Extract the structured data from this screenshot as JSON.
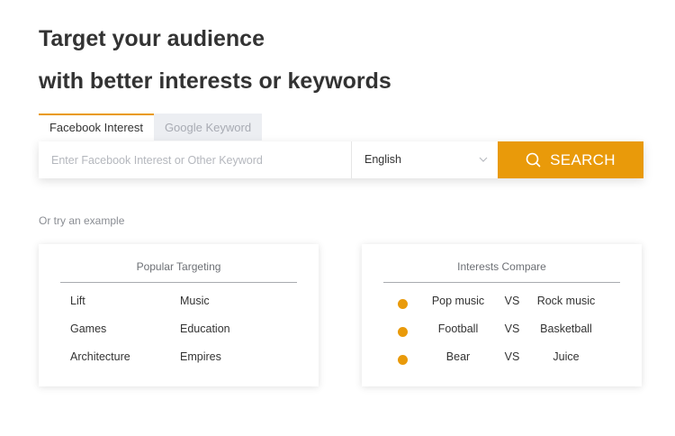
{
  "headline": {
    "line1": "Target your audience",
    "line2": "with better interests or keywords"
  },
  "tabs": [
    {
      "label": "Facebook Interest",
      "active": true
    },
    {
      "label": "Google Keyword",
      "active": false
    }
  ],
  "search": {
    "placeholder": "Enter Facebook Interest or Other Keyword",
    "value": "",
    "language": "English",
    "button_label": "SEARCH"
  },
  "examples_label": "Or try an example",
  "popular": {
    "title": "Popular Targeting",
    "items": [
      "Lift",
      "Music",
      "Games",
      "Education",
      "Architecture",
      "Empires"
    ]
  },
  "compare": {
    "title": "Interests Compare",
    "vs_label": "VS",
    "rows": [
      {
        "a": "Pop music",
        "b": "Rock music"
      },
      {
        "a": "Football",
        "b": "Basketball"
      },
      {
        "a": "Bear",
        "b": "Juice"
      }
    ]
  },
  "colors": {
    "accent": "#e99a0a",
    "tab_inactive_bg": "#eceef2",
    "heading": "#333333"
  },
  "icons": {
    "search_button": "search-icon",
    "language_dropdown": "chevron-down-icon",
    "compare_bullet": "dot-icon"
  }
}
